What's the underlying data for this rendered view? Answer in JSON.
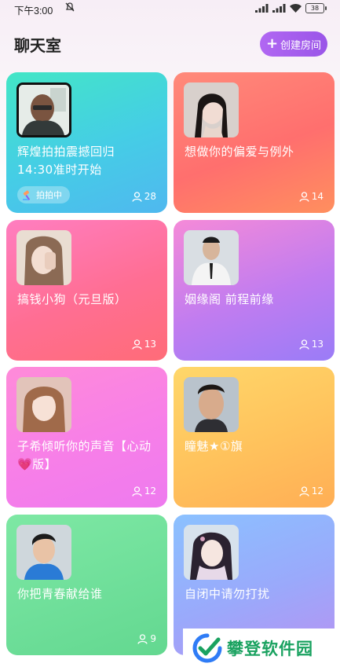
{
  "status": {
    "time": "下午3:00",
    "battery": "38"
  },
  "header": {
    "title": "聊天室",
    "create_label": "创建房间"
  },
  "rooms": [
    {
      "name": "辉煌拍拍震撼回归\n14:30准时开始",
      "tag": "拍拍中",
      "count": "28"
    },
    {
      "name": "想做你的偏爱与例外",
      "count": "14"
    },
    {
      "name": "搞钱小狗（元旦版）",
      "count": "13"
    },
    {
      "name": "姻缘阁 前程前缘",
      "count": "13"
    },
    {
      "name": "子希倾听你的声音【心动💗版】",
      "count": "12"
    },
    {
      "name": "瞳魅★①旗",
      "count": "12"
    },
    {
      "name": "你把青春献给谁",
      "count": "9"
    },
    {
      "name": "自闭中请勿打扰",
      "count": ""
    }
  ],
  "watermark": {
    "text": "攀登软件园"
  },
  "colors": {
    "accent": "#a45cee",
    "watermark": "#1aa260"
  }
}
